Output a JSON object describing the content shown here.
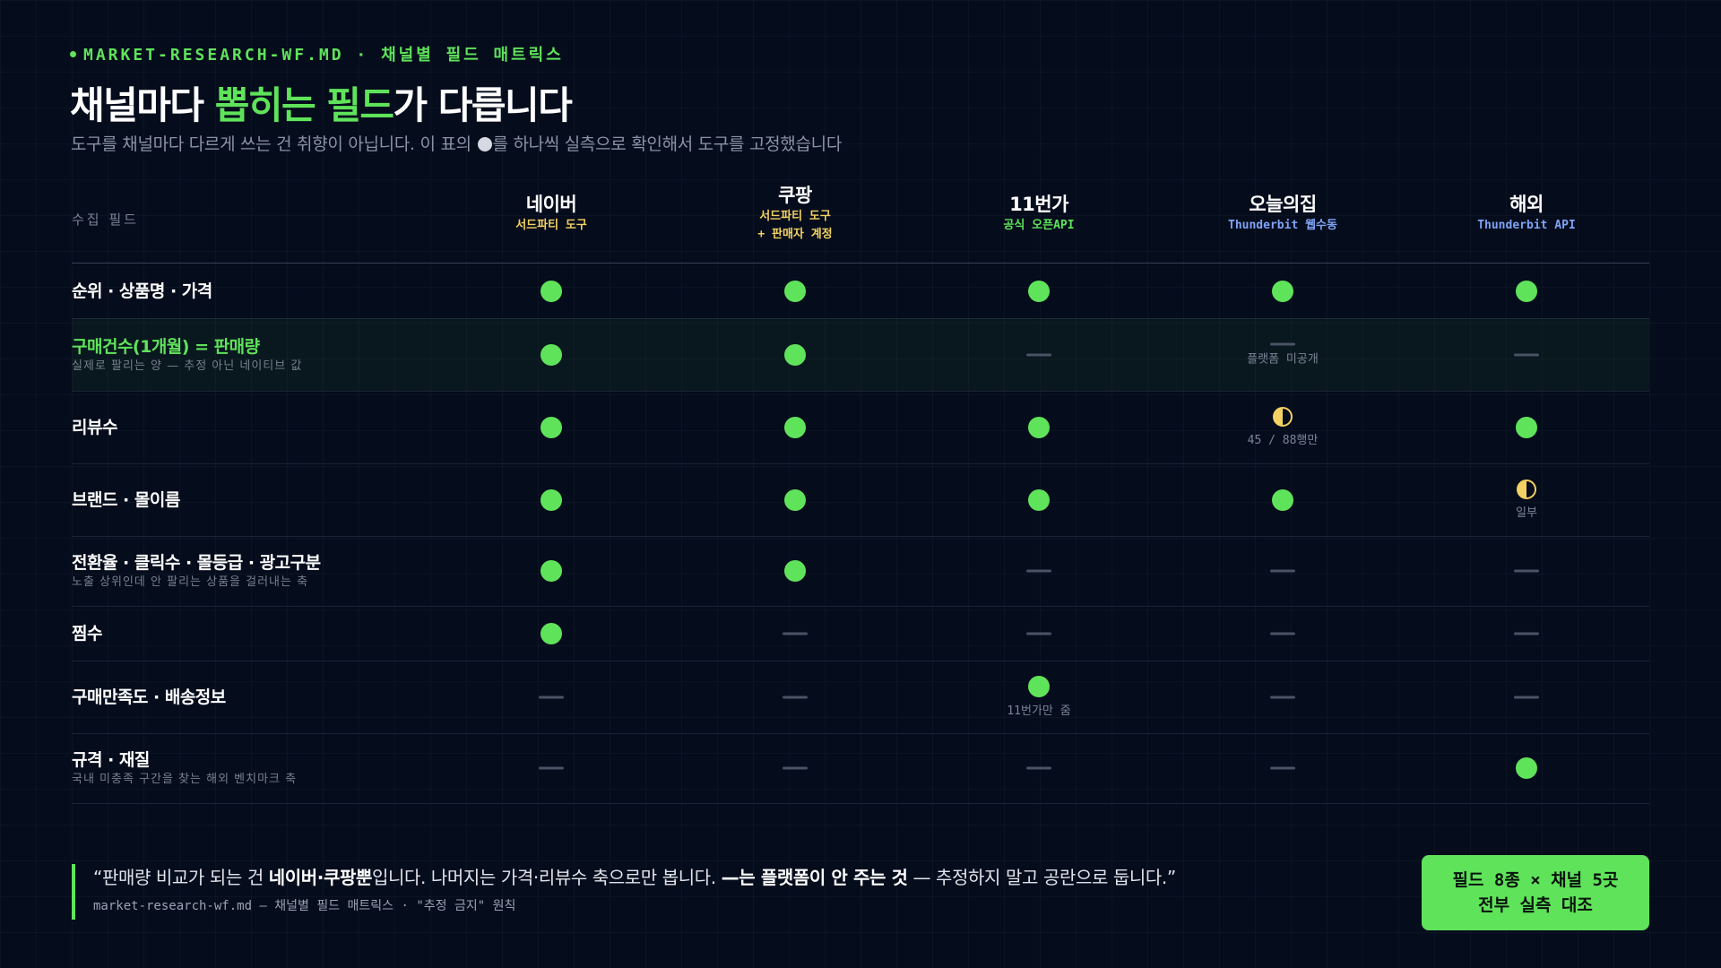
{
  "header": {
    "eyebrow": "MARKET-RESEARCH-WF.MD · 채널별 필드 매트릭스",
    "title_before": "채널마다 ",
    "title_highlight": "뽑히는 필드",
    "title_after": "가 다릅니다",
    "subtitle_before": "도구를 채널마다 다르게 쓰는 건 취향이 아닙니다. 이 표의 ",
    "subtitle_after": "를 하나씩 실측으로 확인해서 도구를 고정했습니다"
  },
  "table": {
    "field_header": "수집 필드",
    "channels": [
      {
        "name": "네이버",
        "source": [
          "서드파티 도구"
        ],
        "source_color": "yellow"
      },
      {
        "name": "쿠팡",
        "source": [
          "서드파티 도구",
          "+ 판매자 계정"
        ],
        "source_color": "yellow"
      },
      {
        "name": "11번가",
        "source": [
          "공식 오픈API"
        ],
        "source_color": "green"
      },
      {
        "name": "오늘의집",
        "source": [
          "Thunderbit 웹수동"
        ],
        "source_color": "blue"
      },
      {
        "name": "해외",
        "source": [
          "Thunderbit API"
        ],
        "source_color": "blue"
      }
    ],
    "rows": [
      {
        "label": "순위 · 상품명 · 가격",
        "note": "",
        "highlight": false,
        "cells": [
          {
            "mark": "full"
          },
          {
            "mark": "full"
          },
          {
            "mark": "full"
          },
          {
            "mark": "full"
          },
          {
            "mark": "full"
          }
        ]
      },
      {
        "label": "구매건수(1개월) = 판매량",
        "note": "실제로 팔리는 양 — 추정 아닌 네이티브 값",
        "highlight": true,
        "cells": [
          {
            "mark": "full"
          },
          {
            "mark": "full"
          },
          {
            "mark": "none"
          },
          {
            "mark": "none",
            "note": "플랫폼 미공개"
          },
          {
            "mark": "none"
          }
        ]
      },
      {
        "label": "리뷰수",
        "note": "",
        "highlight": false,
        "cells": [
          {
            "mark": "full"
          },
          {
            "mark": "full"
          },
          {
            "mark": "full"
          },
          {
            "mark": "half",
            "note": "45 / 88행만"
          },
          {
            "mark": "full"
          }
        ]
      },
      {
        "label": "브랜드 · 몰이름",
        "note": "",
        "highlight": false,
        "cells": [
          {
            "mark": "full"
          },
          {
            "mark": "full"
          },
          {
            "mark": "full"
          },
          {
            "mark": "full"
          },
          {
            "mark": "half",
            "note": "일부"
          }
        ]
      },
      {
        "label": "전환율 · 클릭수 · 몰등급 · 광고구분",
        "note": "노출 상위인데 안 팔리는 상품을 걸러내는 축",
        "highlight": false,
        "cells": [
          {
            "mark": "full"
          },
          {
            "mark": "full"
          },
          {
            "mark": "none"
          },
          {
            "mark": "none"
          },
          {
            "mark": "none"
          }
        ]
      },
      {
        "label": "찜수",
        "note": "",
        "highlight": false,
        "cells": [
          {
            "mark": "full"
          },
          {
            "mark": "none"
          },
          {
            "mark": "none"
          },
          {
            "mark": "none"
          },
          {
            "mark": "none"
          }
        ]
      },
      {
        "label": "구매만족도 · 배송정보",
        "note": "",
        "highlight": false,
        "cells": [
          {
            "mark": "none"
          },
          {
            "mark": "none"
          },
          {
            "mark": "full",
            "note": "11번가만 줌"
          },
          {
            "mark": "none"
          },
          {
            "mark": "none"
          }
        ]
      },
      {
        "label": "규격 · 재질",
        "note": "국내 미충족 구간을 찾는 해외 벤치마크 축",
        "highlight": false,
        "cells": [
          {
            "mark": "none"
          },
          {
            "mark": "none"
          },
          {
            "mark": "none"
          },
          {
            "mark": "none"
          },
          {
            "mark": "full"
          }
        ]
      }
    ]
  },
  "quote": {
    "open": "“판매량 비교가 되는 건 ",
    "bold1": "네이버·쿠팡뿐",
    "mid": "입니다. 나머지는 가격·리뷰수 축으로만 봅니다. ",
    "bold2": "—는 플랫폼이 안 주는 것",
    "close": " — 추정하지 말고 공란으로 둡니다.”",
    "source": "market-research-wf.md — 채널별 필드 매트릭스 · \"추정 금지\" 원칙"
  },
  "badge": {
    "line1": "필드 8종 × 채널 5곳",
    "line2": "전부 실측 대조"
  },
  "colors": {
    "accent_green": "#5fe35a",
    "yellow": "#f3d163",
    "blue": "#7fa3f5",
    "background": "#050c1c"
  }
}
